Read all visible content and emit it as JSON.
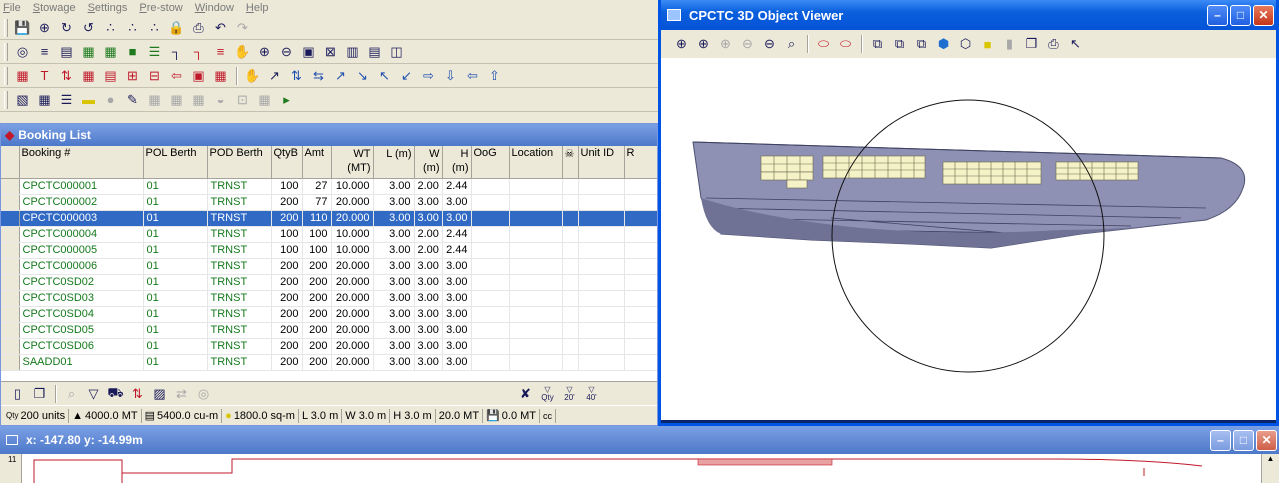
{
  "menu": [
    "File",
    "Stowage",
    "Settings",
    "Pre-stow",
    "Window",
    "Help"
  ],
  "toolbars": {
    "row1": [
      "save-icon",
      "open-icon",
      "vessel-icon",
      "rotate-icon",
      "hatch-icon",
      "hatch2-icon",
      "hatch3-icon",
      "lock-icon",
      "print-icon",
      "undo-icon",
      "redo-icon"
    ],
    "row2": [
      "binoculars-icon",
      "layers-icon",
      "stack-icon",
      "grid-icon",
      "grid2-icon",
      "block-icon",
      "stack2-icon",
      "tank-icon",
      "tank2-icon",
      "compare-icon",
      "hand-icon",
      "zoom-in-icon",
      "zoom-out-icon",
      "view-icon",
      "fit-icon",
      "columns-icon",
      "rows-icon",
      "split-icon"
    ],
    "row3": [
      "calc-icon",
      "text-icon",
      "swap-icon",
      "grid-a-icon",
      "grid-b-icon",
      "grid-c-icon",
      "frame-icon",
      "back-icon",
      "frame2-icon",
      "grid-d-icon",
      "hand2-icon",
      "arrow-tool-icon",
      "swap-v-icon",
      "swap-h-icon",
      "diag-a-icon",
      "diag-b-icon",
      "diag-c-icon",
      "diag-d-icon",
      "right-arrow-icon",
      "down-arrow-icon",
      "left-arrow-icon",
      "up-arrow-icon"
    ],
    "row4": [
      "hatch-fill-icon",
      "grid-fill-icon",
      "list-icon",
      "yellow-box-icon",
      "sphere-icon",
      "marker-icon",
      "block-a-icon",
      "block-b-icon",
      "block-c-icon",
      "shape-icon",
      "shape2-icon",
      "shape3-icon",
      "next-icon"
    ]
  },
  "booking_list": {
    "title": "Booking List",
    "columns": [
      "Booking #",
      "POL Berth",
      "POD Berth",
      "QtyB",
      "Amt",
      "WT (MT)",
      "L (m)",
      "W (m)",
      "H (m)",
      "OoG",
      "Location",
      "",
      "Unit ID",
      "R"
    ],
    "rows": [
      {
        "booking": "CPCTC000001",
        "pol": "01",
        "pod": "TRNST",
        "qtyb": "100",
        "amt": "27",
        "wt": "10.000",
        "l": "3.00",
        "w": "2.00",
        "h": "2.44"
      },
      {
        "booking": "CPCTC000002",
        "pol": "01",
        "pod": "TRNST",
        "qtyb": "200",
        "amt": "77",
        "wt": "20.000",
        "l": "3.00",
        "w": "3.00",
        "h": "3.00"
      },
      {
        "booking": "CPCTC000003",
        "pol": "01",
        "pod": "TRNST",
        "qtyb": "200",
        "amt": "110",
        "wt": "20.000",
        "l": "3.00",
        "w": "3.00",
        "h": "3.00",
        "selected": true
      },
      {
        "booking": "CPCTC000004",
        "pol": "01",
        "pod": "TRNST",
        "qtyb": "100",
        "amt": "100",
        "wt": "10.000",
        "l": "3.00",
        "w": "2.00",
        "h": "2.44"
      },
      {
        "booking": "CPCTC000005",
        "pol": "01",
        "pod": "TRNST",
        "qtyb": "100",
        "amt": "100",
        "wt": "10.000",
        "l": "3.00",
        "w": "2.00",
        "h": "2.44"
      },
      {
        "booking": "CPCTC000006",
        "pol": "01",
        "pod": "TRNST",
        "qtyb": "200",
        "amt": "200",
        "wt": "20.000",
        "l": "3.00",
        "w": "3.00",
        "h": "3.00"
      },
      {
        "booking": "CPCTC0SD02",
        "pol": "01",
        "pod": "TRNST",
        "qtyb": "200",
        "amt": "200",
        "wt": "20.000",
        "l": "3.00",
        "w": "3.00",
        "h": "3.00"
      },
      {
        "booking": "CPCTC0SD03",
        "pol": "01",
        "pod": "TRNST",
        "qtyb": "200",
        "amt": "200",
        "wt": "20.000",
        "l": "3.00",
        "w": "3.00",
        "h": "3.00"
      },
      {
        "booking": "CPCTC0SD04",
        "pol": "01",
        "pod": "TRNST",
        "qtyb": "200",
        "amt": "200",
        "wt": "20.000",
        "l": "3.00",
        "w": "3.00",
        "h": "3.00"
      },
      {
        "booking": "CPCTC0SD05",
        "pol": "01",
        "pod": "TRNST",
        "qtyb": "200",
        "amt": "200",
        "wt": "20.000",
        "l": "3.00",
        "w": "3.00",
        "h": "3.00"
      },
      {
        "booking": "CPCTC0SD06",
        "pol": "01",
        "pod": "TRNST",
        "qtyb": "200",
        "amt": "200",
        "wt": "20.000",
        "l": "3.00",
        "w": "3.00",
        "h": "3.00"
      },
      {
        "booking": "SAADD01",
        "pol": "01",
        "pod": "TRNST",
        "qtyb": "200",
        "amt": "200",
        "wt": "20.000",
        "l": "3.00",
        "w": "3.00",
        "h": "3.00"
      }
    ],
    "tool_labels": {
      "qty": "Qty",
      "q20": "20'",
      "q40": "40'"
    },
    "status": {
      "qty_prefix": "Qty",
      "units": "200 units",
      "weight": "4000.0 MT",
      "volume": "5400.0 cu-m",
      "area": "1800.0 sq-m",
      "l": "L  3.0 m",
      "w": "W 3.0 m",
      "h": "H  3.0 m",
      "mt": "20.0 MT",
      "extra": "0.0 MT",
      "cc": "cc"
    }
  },
  "viewer": {
    "title": "CPCTC 3D Object Viewer",
    "tools": [
      "zoom-in-icon",
      "zoom-plus-icon",
      "zoom-disabled-icon",
      "zoom-disabled2-icon",
      "zoom-out-icon",
      "zoom-area-icon",
      "orbit-icon",
      "orbit2-icon",
      "view-front-icon",
      "view-side-icon",
      "view-top-icon",
      "view-iso-icon",
      "box-icon",
      "light-icon",
      "hull-icon",
      "copy-view-icon",
      "print-view-icon",
      "pointer-icon"
    ]
  },
  "profile": {
    "title": "x: -147.80   y: -14.99m",
    "ruler_label": "11"
  },
  "colors": {
    "selected_row": "#316ac5",
    "booking_text": "#137a1b",
    "hull": "#8e91b3",
    "container": "#f5f2c8"
  }
}
